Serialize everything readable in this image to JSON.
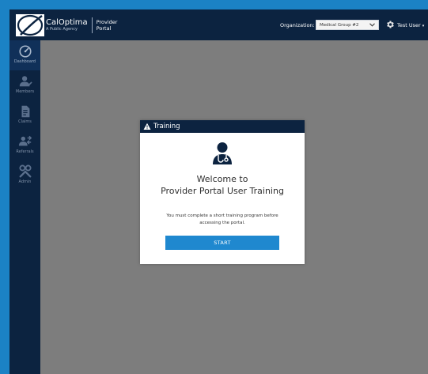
{
  "header": {
    "brand": "CalOptima",
    "brand_sub": "A Public Agency",
    "portal_name": "Provider\nPortal",
    "org_label": "Organization:",
    "org_selected": "Medical Group #2",
    "settings_icon": "gear-icon",
    "user_name": "Test User",
    "user_caret": "▾"
  },
  "sidebar": {
    "items": [
      {
        "label": "Dashboard",
        "icon": "dashboard-icon",
        "active": true
      },
      {
        "label": "Members",
        "icon": "members-icon",
        "active": false
      },
      {
        "label": "Claims",
        "icon": "claims-icon",
        "active": false
      },
      {
        "label": "Referrals",
        "icon": "referrals-icon",
        "active": false
      },
      {
        "label": "Admin",
        "icon": "admin-icon",
        "active": false
      }
    ]
  },
  "modal": {
    "title": "Training",
    "title_icon": "warning-icon",
    "hero_icon": "doctor-icon",
    "welcome_line1": "Welcome to",
    "welcome_line2": "Provider Portal User Training",
    "notice_line1": "You must complete a short training program before",
    "notice_line2": "accessing the portal.",
    "start_label": "START"
  },
  "colors": {
    "navy": "#0c2340",
    "accent_blue": "#1f88cf",
    "overlay_gray": "#7d7d7d",
    "outer_blue": "#1b82c5"
  }
}
